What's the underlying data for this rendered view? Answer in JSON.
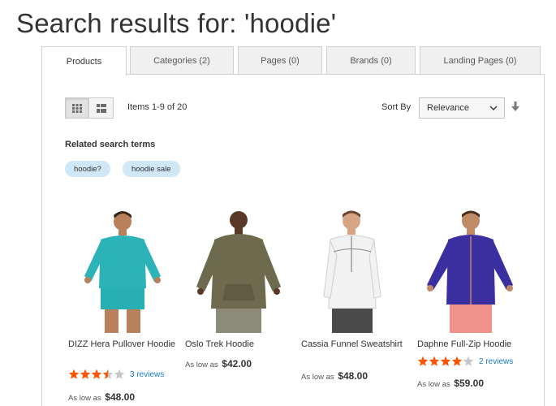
{
  "page": {
    "title": "Search results for: 'hoodie'"
  },
  "tabs": [
    {
      "label": "Products",
      "active": true
    },
    {
      "label": "Categories (2)",
      "active": false
    },
    {
      "label": "Pages (0)",
      "active": false
    },
    {
      "label": "Brands (0)",
      "active": false
    },
    {
      "label": "Landing Pages (0)",
      "active": false
    }
  ],
  "toolbar": {
    "view_modes": [
      "grid-icon",
      "list-icon"
    ],
    "active_view": "grid",
    "items_text": "Items 1-9 of 20",
    "sort_label": "Sort By",
    "sort_value": "Relevance",
    "sort_direction_icon": "arrow-down-icon"
  },
  "related": {
    "title": "Related search terms",
    "terms": [
      "hoodie?",
      "hoodie sale"
    ]
  },
  "products": [
    {
      "name": "DIZZ Hera Pullover Hoodie",
      "rating": 3.5,
      "reviews": "3 reviews",
      "price_prefix": "As low as",
      "price": "$48.00",
      "shirt_color": "#2bb3b8",
      "bottom_color": "#27b0b4"
    },
    {
      "name": "Oslo Trek Hoodie",
      "rating": null,
      "reviews": "",
      "price_prefix": "As low as",
      "price": "$42.00",
      "shirt_color": "#6d6a4e",
      "bottom_color": "#8c8a78"
    },
    {
      "name": "Cassia Funnel Sweatshirt",
      "rating": null,
      "reviews": "",
      "price_prefix": "As low as",
      "price": "$48.00",
      "shirt_color": "#f2f2f2",
      "bottom_color": "#4a4a4a"
    },
    {
      "name": "Daphne Full-Zip Hoodie",
      "rating": 4,
      "reviews": "2 reviews",
      "price_prefix": "As low as",
      "price": "$59.00",
      "shirt_color": "#3a2fa0",
      "bottom_color": "#f0918a"
    }
  ],
  "colors": {
    "accent_link": "#1979c3",
    "star_filled": "#ff5501",
    "star_empty": "#c7c7c7",
    "chip_bg": "#cfe7f7"
  }
}
